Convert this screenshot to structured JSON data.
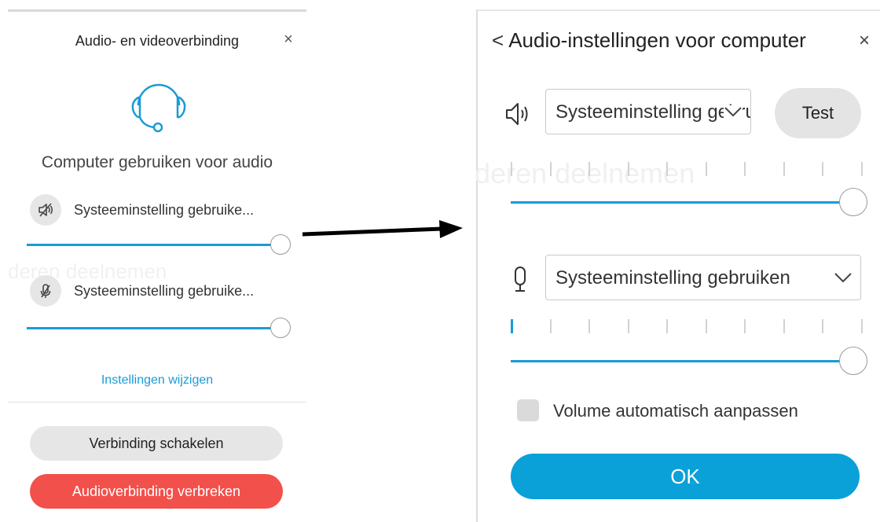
{
  "left_panel": {
    "title": "Audio- en videoverbinding",
    "close_glyph": "×",
    "caption": "Computer gebruiken voor audio",
    "speaker_label": "Systeeminstelling gebruike...",
    "microphone_label": "Systeeminstelling gebruike...",
    "speaker_volume": 1.0,
    "microphone_volume": 1.0,
    "ghost_text": "deren deelnemen",
    "settings_link": "Instellingen wijzigen",
    "switch_button": "Verbinding schakelen",
    "disconnect_button": "Audioverbinding verbreken"
  },
  "right_panel": {
    "back_glyph": "<",
    "title": "Audio-instellingen voor computer",
    "close_glyph": "×",
    "speaker_select": "Systeeminstelling gebruiken",
    "test_button": "Test",
    "ghost_text": "deren deelnemen",
    "speaker_volume": 1.0,
    "microphone_select": "Systeeminstelling gebruiken",
    "mic_level_active_ticks": 1,
    "microphone_volume": 1.0,
    "auto_adjust_label": "Volume automatisch aanpassen",
    "auto_adjust_checked": false,
    "ok_button": "OK"
  },
  "icons": {
    "headset": "headset-icon",
    "speaker_muted": "speaker-muted-icon",
    "mic_muted": "microphone-muted-icon",
    "speaker": "speaker-icon",
    "microphone": "microphone-icon",
    "chevron": "chevron-down-icon",
    "arrow": "arrow-right-icon"
  },
  "colors": {
    "accent": "#1a9bd6",
    "ok_button": "#0aa0d8",
    "disconnect": "#f2504b",
    "neutral_button": "#e6e6e6"
  }
}
